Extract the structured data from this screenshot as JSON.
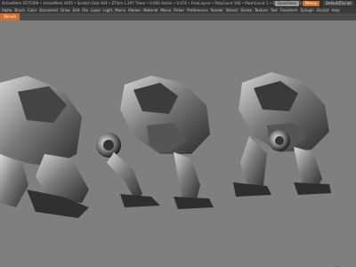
{
  "titlebar": {
    "status": "ActiveMem 2575398 • ActiveMem 4495 • Scratch Disk 464 • ZTime 1.297 Timer • 0.664 Active • 0.474 • FreeLayers • PolyCount 160 • MeshCount 1 • Quicksave in 11min",
    "search_label": "QuickSave",
    "menu_label": "Menus",
    "default_label": "DefaultZScript"
  },
  "menubar": {
    "items": [
      "Alpha",
      "Brush",
      "Color",
      "Document",
      "Draw",
      "Edit",
      "File",
      "Layer",
      "Light",
      "Macro",
      "Marker",
      "Material",
      "Movie",
      "Picker",
      "Preferences",
      "Render",
      "Stencil",
      "Stroke",
      "Texture",
      "Tool",
      "Transform",
      "Zplugin",
      "Zscript",
      "Help"
    ]
  },
  "toolbar": {
    "doc_tab": "Zbrush"
  },
  "colors": {
    "accent": "#d36f2b",
    "background": "#7f7f7f"
  },
  "icons": {
    "nav": "gizmo-icon"
  }
}
